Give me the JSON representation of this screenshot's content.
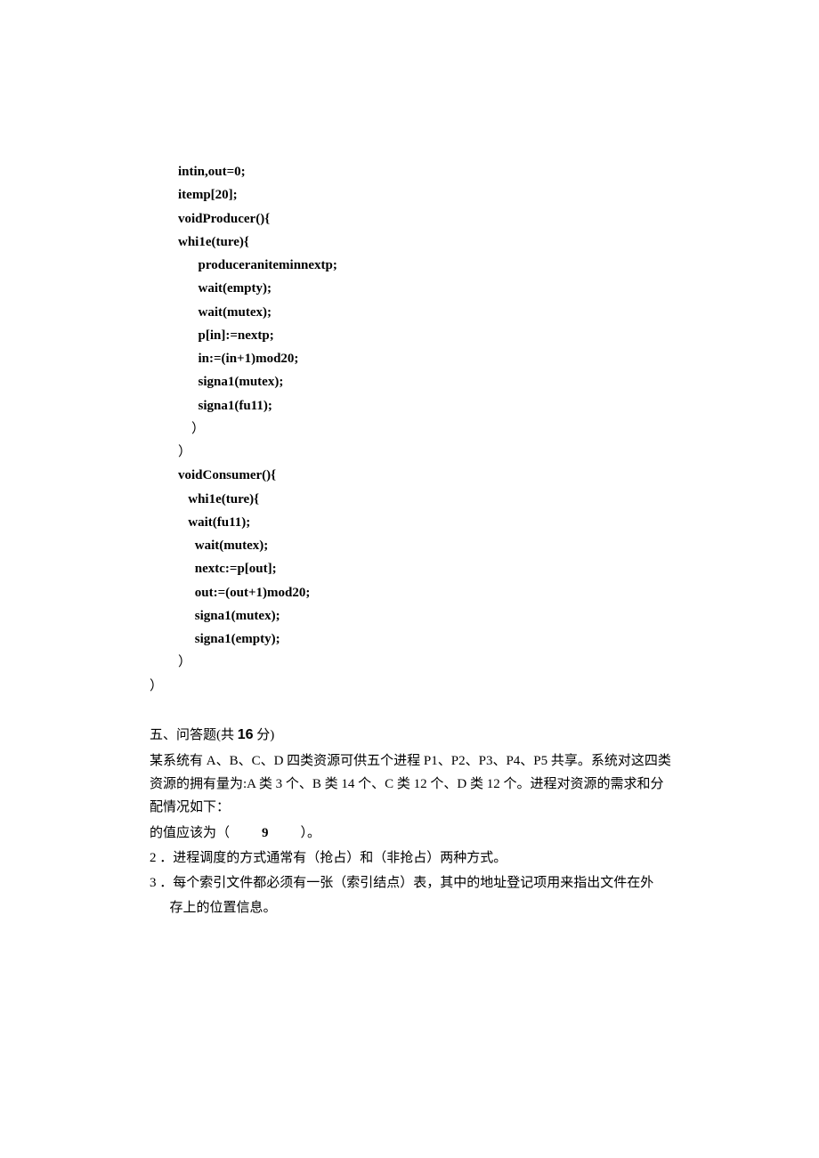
{
  "code": {
    "l01": "intin,out=0;",
    "l02": "itemp[20];",
    "l03": "voidProducer(){",
    "l04": "whi1e(ture){",
    "l05": "produceraniteminnextp;",
    "l06": "wait(empty);",
    "l07": "wait(mutex);",
    "l08": "p[in]:=nextp;",
    "l09": "in:=(in+1)mod20;",
    "l10": "signa1(mutex);",
    "l11": "signa1(fu11);",
    "l12": "）",
    "l13": "）",
    "l14": "voidConsumer(){",
    "l15": "whi1e(ture){",
    "l16": "wait(fu11);",
    "l17": "wait(mutex);",
    "l18": "nextc:=p[out];",
    "l19": "out:=(out+1)mod20;",
    "l20": "signa1(mutex);",
    "l21": "signa1(empty);",
    "l22": "）",
    "l23": "）"
  },
  "section5": {
    "heading_prefix": "五、问答题(共 ",
    "heading_num": "16",
    "heading_suffix": " 分)",
    "p1": "某系统有 A、B、C、D 四类资源可供五个进程 P1、P2、P3、P4、P5 共享。系统对这四类资源的拥有量为:A 类 3 个、B 类 14 个、C 类 12 个、D 类 12 个。进程对资源的需求和分配情况如下：",
    "p2_prefix": "的值应该为（",
    "p2_value": "9",
    "p2_suffix": "）。",
    "li2": "2 ．进程调度的方式通常有（抢占）和（非抢占）两种方式。",
    "li3a": "3 ．每个索引文件都必须有一张（索引结点）表，其中的地址登记项用来指出文件在外",
    "li3b": "存上的位置信息。"
  }
}
